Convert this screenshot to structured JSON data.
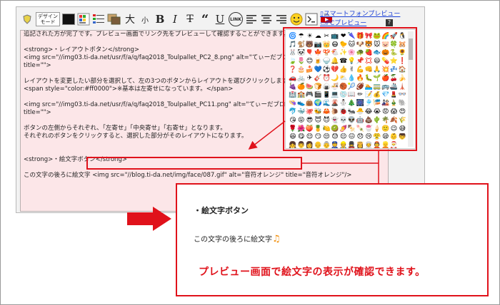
{
  "toolbar": {
    "design_mode_label": "デザイン\nモード",
    "large_label": "大",
    "small_label": "小",
    "bold_label": "B",
    "italic_label": "I",
    "strike_label": "T",
    "quote_label": "“",
    "underline_label": "U",
    "link_label": "LINK",
    "help_label": "?"
  },
  "preview_links": {
    "smartphone": "スマートフォンプレビュー",
    "pc": "PCプレビュー",
    "help": "?"
  },
  "editor": {
    "lines": [
      "追記された方が完了です。プレビュー画面でリンク先をプレビューして確認することができます。",
      "",
      "<strong>・レイアウトボタン</strong>",
      "<img src=\"//img03.ti-da.net/usr/f/a/q/faq2018_Toulpallet_PC2_8.png\" alt=\"てぃーだブログ 記事投稿",
      "title=\"\">",
      "",
      "レイアウトを変更したい部分を選択して、左の3つのボタンからレイアウトを選びクリックします。",
      "<span style=\"color:#ff0000\">※基本は左寄せになっています。</span>",
      "",
      "<img src=\"//img03.ti-da.net/usr/f/a/q/faq2018_Toulpallet_PC11.png\" alt=\"てぃーだブログ 記事投稿",
      "title=\"\">",
      "",
      "ボタンの左側からそれぞれ、「左寄せ」「中央寄せ」「右寄せ」となります。",
      "それぞれのボタンをクリックすると、選択した部分がそのレイアウトになります。",
      "",
      "",
      "<strong>・絵文字ボタン</strong>",
      "",
      "この文字の後ろに絵文字 <img src=\"//blog.ti-da.net/img/face/087.gif\" alt=\"音符オレンジ\" title=\"音符オレンジ\"/>"
    ]
  },
  "palette": {
    "emojis": [
      "🌀",
      "☂",
      "☀",
      "☁",
      "✂",
      "📺",
      "❤",
      "🌂",
      "🎁",
      "🎀",
      "🐸",
      "🌈",
      "🚀",
      "🐧",
      "🎵",
      "🐒",
      "🐻",
      "📷",
      "👑",
      "😷",
      "🐤",
      "🐱",
      "🐶",
      "🐯",
      "🐭",
      "🐷",
      "🍀",
      "🐹",
      "🐰",
      "🐼",
      "🎈",
      "🍁",
      "🍄",
      "🐔",
      "✨",
      "🌸",
      "🐢",
      "🍓",
      "🐟",
      "🎃",
      "🐍",
      "🌻",
      "🍃",
      "🌷",
      "😊",
      "🍺",
      "🍚",
      "🔔",
      "☎",
      "💡",
      "📌",
      "💢",
      "😃",
      "💊",
      "⭐",
      "❗",
      "❓",
      "🎂",
      "🍰",
      "💙",
      "⚽",
      "💔",
      "👍",
      "✌",
      "💪",
      "👊",
      "🙏",
      "💥",
      "💤",
      "🏠",
      "🚗",
      "🚲",
      "✈",
      "🎸",
      "⏰",
      "🌙",
      "⛅",
      "💧",
      "🔥",
      "🐛",
      "🌱",
      "🍎",
      "🍒",
      "🍌",
      "🍇",
      "🍊",
      "🍉",
      "🍞",
      "🍙",
      "🍜",
      "🏀",
      "🎾",
      "🏈",
      "🏊",
      "🚃",
      "🚌",
      "🚢",
      "🗼",
      "🏥",
      "🏫",
      "🎮",
      "🎬",
      "📱",
      "💻",
      "💿",
      "📖",
      "✏",
      "📝",
      "💰",
      "💎",
      "💄",
      "👓",
      "👒",
      "👟",
      "👜",
      "🌍",
      "🌊",
      "🌋",
      "⛄",
      "🎄",
      "🎆",
      "🎐",
      "🎏",
      "🎎",
      "🎍",
      "🐘",
      "🐬",
      "🐳",
      "🐙",
      "🐝",
      "🦀",
      "🐌",
      "🐞",
      "🐜",
      "🐣",
      "😂",
      "😭",
      "😡",
      "😱",
      "😍",
      "😘",
      "😜",
      "😎",
      "😇",
      "😈",
      "👻",
      "💀",
      "👽",
      "🤖",
      "💩",
      "🌵",
      "🌴",
      "🍂",
      "🌾",
      "🌹",
      "🌺",
      "🍑",
      "🍍",
      "🍋",
      "🥝",
      "🍠",
      "🍢",
      "🍡",
      "🍧",
      "🍦",
      "🙂",
      "😉",
      "😅",
      "😆",
      "😋",
      "😌",
      "😏",
      "😒",
      "😓",
      "😔",
      "😖",
      "😞",
      "😢",
      "😤",
      "😪",
      "👶",
      "👦",
      "👧",
      "👨",
      "👩",
      "👴",
      "👵",
      "👮",
      "👷",
      "💂",
      "👸",
      "👳",
      "👲",
      "👱",
      "🎅"
    ]
  },
  "preview": {
    "heading": "・絵文字ボタン",
    "body_text": "この文字の後ろに絵文字",
    "emoji": "♫",
    "note": "プレビュー画面で絵文字の表示が確認できます。"
  },
  "colors": {
    "accent_red": "#e0121b",
    "textarea_bg": "#fce6e8",
    "link_blue": "#1a3fd6"
  }
}
